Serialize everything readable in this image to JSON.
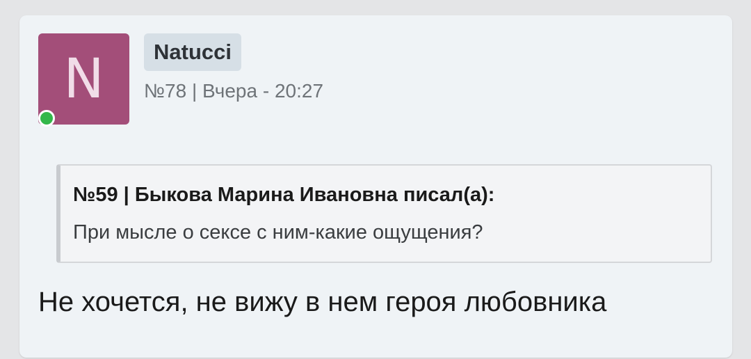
{
  "author": {
    "avatar_letter": "N",
    "avatar_color": "#a34e79",
    "online_status_color": "#33b74a",
    "username": "Natucci"
  },
  "post": {
    "meta": "№78 | Вчера - 20:27",
    "quote": {
      "header": "№59 | Быкова Марина Ивановна писал(а):",
      "text": "При мысле о сексе с ним-какие ощущения?"
    },
    "body": "Не хочется, не вижу в нем героя любовника"
  }
}
